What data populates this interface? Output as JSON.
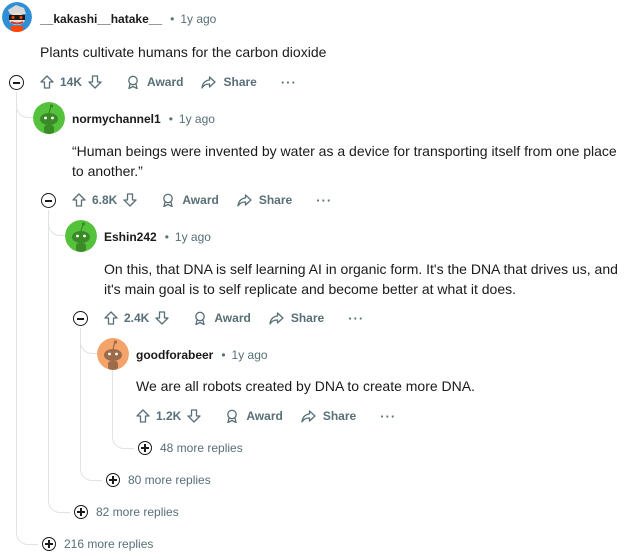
{
  "comments": [
    {
      "username": "__kakashi__hatake__",
      "time": "1y ago",
      "text": "Plants cultivate humans for the carbon dioxide",
      "votes": "14K",
      "avatar_icon": "snoo-avatar-icon",
      "avatar_color": "#2e8fd6"
    },
    {
      "username": "normychannel1",
      "time": "1y ago",
      "text": "“Human beings were invented by water as a device for transporting itself from one place to another.”",
      "votes": "6.8K",
      "avatar_icon": "snoo-avatar-icon",
      "avatar_color": "#54c23a"
    },
    {
      "username": "Eshin242",
      "time": "1y ago",
      "text": "On this, that DNA is self learning AI in organic form. It's the DNA that drives us, and it's main goal is to self replicate and become better at what it does.",
      "votes": "2.4K",
      "avatar_icon": "snoo-avatar-icon",
      "avatar_color": "#54c23a"
    },
    {
      "username": "goodforabeer",
      "time": "1y ago",
      "text": "We are all robots created by DNA to create more DNA.",
      "votes": "1.2K",
      "avatar_icon": "snoo-avatar-icon",
      "avatar_color": "#f4a46a"
    }
  ],
  "actions": {
    "award": "Award",
    "share": "Share",
    "more": "···"
  },
  "dot": "•",
  "more_replies": [
    "48 more replies",
    "80 more replies",
    "82 more replies",
    "216 more replies"
  ]
}
